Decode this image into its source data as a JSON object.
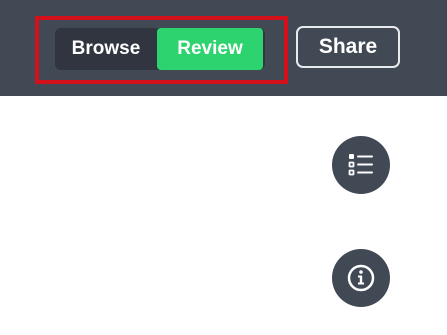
{
  "header": {
    "mode_toggle": {
      "options": [
        {
          "label": "Browse",
          "selected": false
        },
        {
          "label": "Review",
          "selected": true
        }
      ]
    },
    "share_label": "Share"
  },
  "floating_actions": [
    {
      "icon": "list-icon"
    },
    {
      "icon": "info-icon"
    }
  ],
  "colors": {
    "header_bg": "#414955",
    "toggle_bg": "#30353f",
    "active_tab": "#2dd36f",
    "highlight_frame": "#d4111b",
    "fab_bg": "#414955"
  }
}
